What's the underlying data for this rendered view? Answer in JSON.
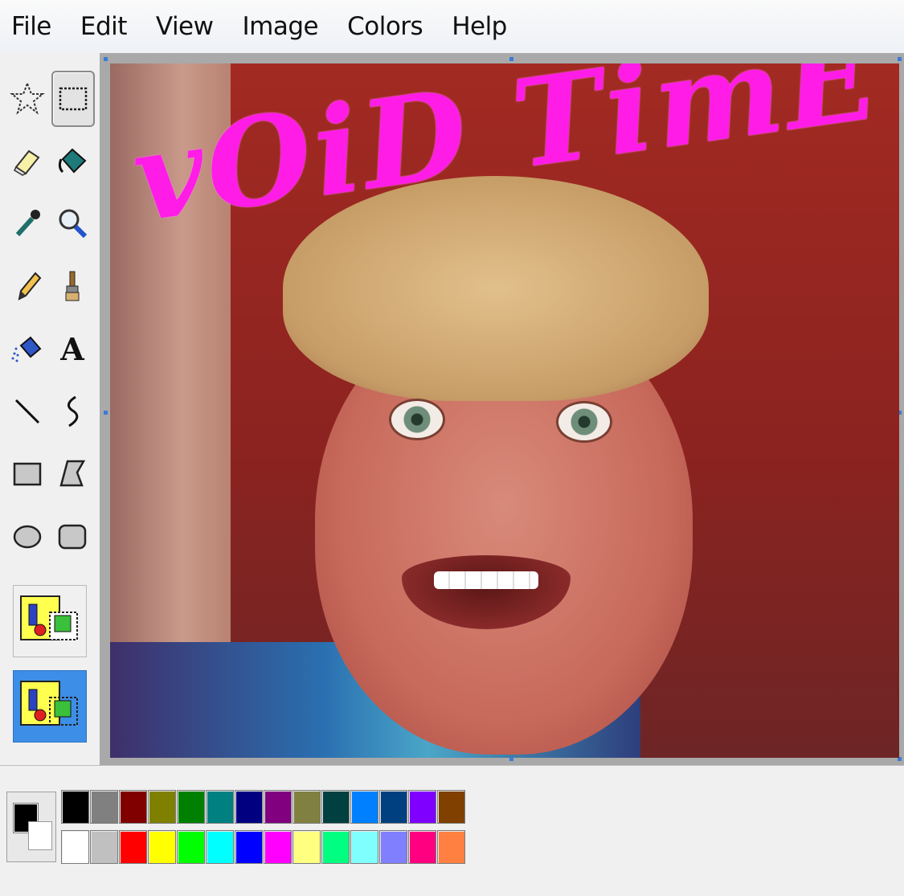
{
  "menu": [
    "File",
    "Edit",
    "View",
    "Image",
    "Colors",
    "Help"
  ],
  "tools": [
    {
      "name": "free-form-select-icon",
      "selected": false
    },
    {
      "name": "rectangle-select-icon",
      "selected": true
    },
    {
      "name": "eraser-icon",
      "selected": false
    },
    {
      "name": "fill-bucket-icon",
      "selected": false
    },
    {
      "name": "eyedropper-icon",
      "selected": false
    },
    {
      "name": "magnifier-icon",
      "selected": false
    },
    {
      "name": "pencil-icon",
      "selected": false
    },
    {
      "name": "brush-icon",
      "selected": false
    },
    {
      "name": "airbrush-icon",
      "selected": false
    },
    {
      "name": "text-icon",
      "selected": false
    },
    {
      "name": "line-icon",
      "selected": false
    },
    {
      "name": "curve-icon",
      "selected": false
    },
    {
      "name": "rectangle-icon",
      "selected": false
    },
    {
      "name": "polygon-icon",
      "selected": false
    },
    {
      "name": "ellipse-icon",
      "selected": false
    },
    {
      "name": "rounded-rectangle-icon",
      "selected": false
    }
  ],
  "text_tool_glyph": "A",
  "canvas": {
    "overlay_text": "vOiD TimE",
    "overlay_color": "#ff1ce6"
  },
  "palette": {
    "foreground": "#000000",
    "background": "#ffffff",
    "row1": [
      "#000000",
      "#808080",
      "#800000",
      "#808000",
      "#008000",
      "#008080",
      "#000080",
      "#800080",
      "#808040",
      "#004040",
      "#0080ff",
      "#004080",
      "#8000ff",
      "#804000"
    ],
    "row2": [
      "#ffffff",
      "#c0c0c0",
      "#ff0000",
      "#ffff00",
      "#00ff00",
      "#00ffff",
      "#0000ff",
      "#ff00ff",
      "#ffff80",
      "#00ff80",
      "#80ffff",
      "#8080ff",
      "#ff0080",
      "#ff8040"
    ]
  }
}
